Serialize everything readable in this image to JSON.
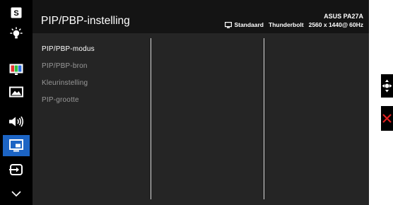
{
  "header": {
    "title": "PIP/PBP-instelling",
    "model": "ASUS PA27A",
    "mode": "Standaard",
    "input": "Thunderbolt",
    "resolution": "2560 x 1440@",
    "refresh": "60Hz"
  },
  "menu": {
    "items": [
      {
        "label": "PIP/PBP-modus",
        "state": "selected"
      },
      {
        "label": "PIP/PBP-bron",
        "state": "disabled"
      },
      {
        "label": "Kleurinstelling",
        "state": "disabled"
      },
      {
        "label": "PIP-grootte",
        "state": "disabled"
      }
    ]
  },
  "sidebar": {
    "icons": [
      {
        "name": "splendid-icon",
        "glyph": "S"
      },
      {
        "name": "brightness-icon"
      },
      {
        "name": "color-icon"
      },
      {
        "name": "image-icon"
      },
      {
        "name": "sound-icon"
      },
      {
        "name": "pip-pbp-icon",
        "active": true
      },
      {
        "name": "input-select-icon"
      },
      {
        "name": "chevron-down-icon"
      }
    ]
  },
  "colors": {
    "active": "#1c64c4",
    "panel": "#252525",
    "header": "#141414",
    "rail": "#000000",
    "exit": "#e02020"
  },
  "nav": {
    "move_icon": "joystick-move-icon",
    "exit_icon": "exit-icon"
  }
}
